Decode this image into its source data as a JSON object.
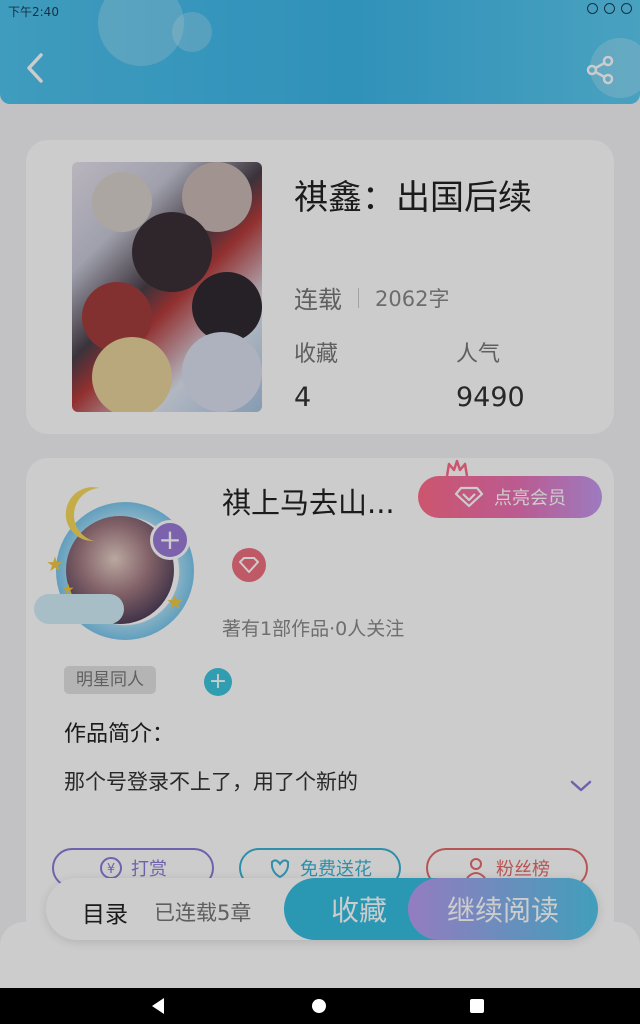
{
  "status_bar": {
    "time": "下午2:40"
  },
  "book": {
    "title": "祺鑫：出国后续",
    "status": "连载",
    "word_count": "2062字",
    "favorites_label": "收藏",
    "favorites_value": "4",
    "popularity_label": "人气",
    "popularity_value": "9490"
  },
  "author": {
    "name": "祺上马去山...",
    "vip_button_label": "点亮会员",
    "stats": "著有1部作品·0人关注",
    "genre_tag": "明星同人"
  },
  "intro": {
    "title": "作品简介：",
    "text": "那个号登录不上了，用了个新的"
  },
  "actions": {
    "tip_label": "打赏",
    "flower_label": "免费送花",
    "fans_label": "粉丝榜"
  },
  "bottom_bar": {
    "toc_label": "目录",
    "chapter_count": "已连载5章",
    "collect_label": "收藏",
    "read_label": "继续阅读"
  },
  "colors": {
    "header": "#3db6e8",
    "accent_cyan": "#35bde0",
    "accent_purple": "#9c7ad9",
    "vip_pink": "#ff6b8a",
    "tip_purple": "#8d7ad8",
    "flower_cyan": "#3ab3d6",
    "fans_red": "#e56b6b"
  },
  "icons": {
    "back": "chevron-left-icon",
    "share": "share-icon",
    "plus": "plus-icon",
    "diamond": "diamond-icon",
    "crown": "crown-icon",
    "expand": "chevron-down-icon",
    "yen": "yen-icon",
    "flower": "flower-icon",
    "person": "person-icon"
  }
}
